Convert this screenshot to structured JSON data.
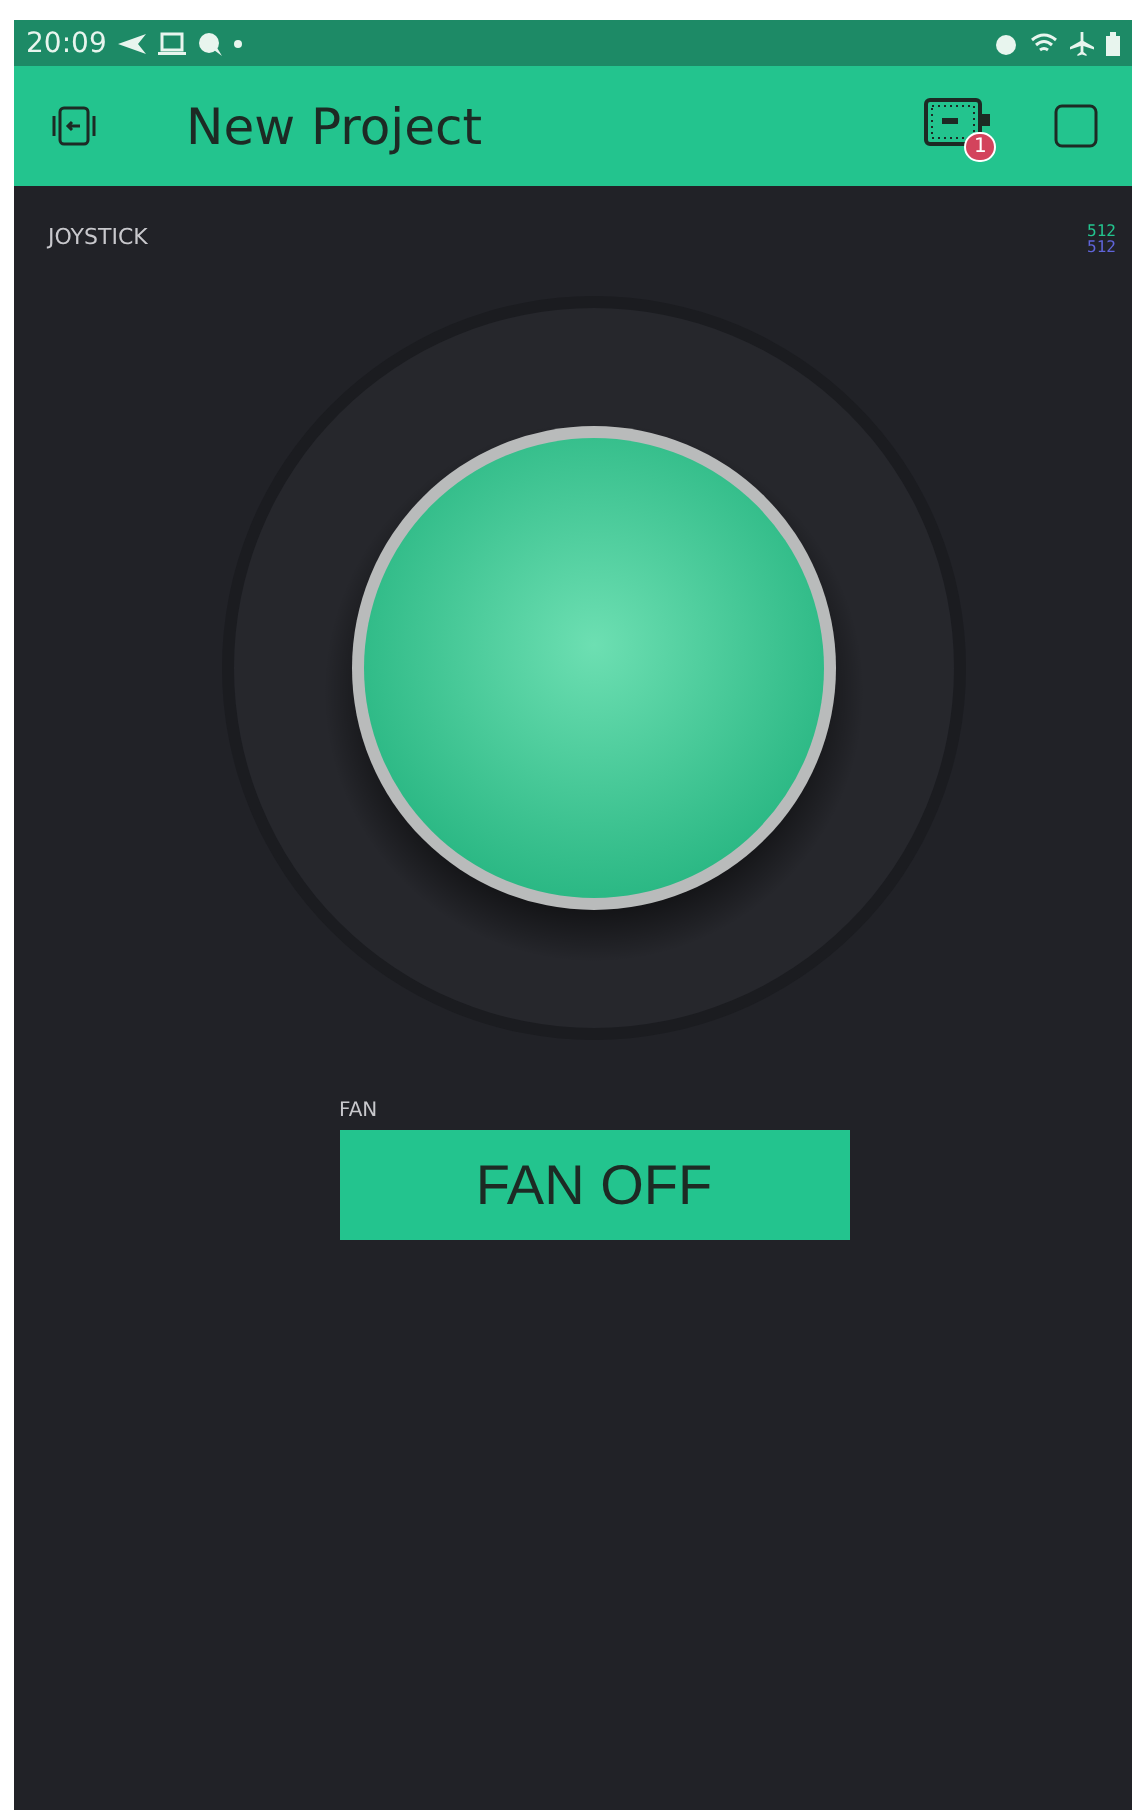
{
  "status_bar": {
    "time": "20:09"
  },
  "app_bar": {
    "title": "New Project",
    "badge": "1"
  },
  "joystick": {
    "label": "JOYSTICK",
    "values": [
      {
        "text": "512",
        "color": "#23c48e"
      },
      {
        "text": "512",
        "color": "#5f64d8"
      }
    ]
  },
  "button": {
    "label": "FAN",
    "text": "FAN OFF",
    "on": false
  }
}
